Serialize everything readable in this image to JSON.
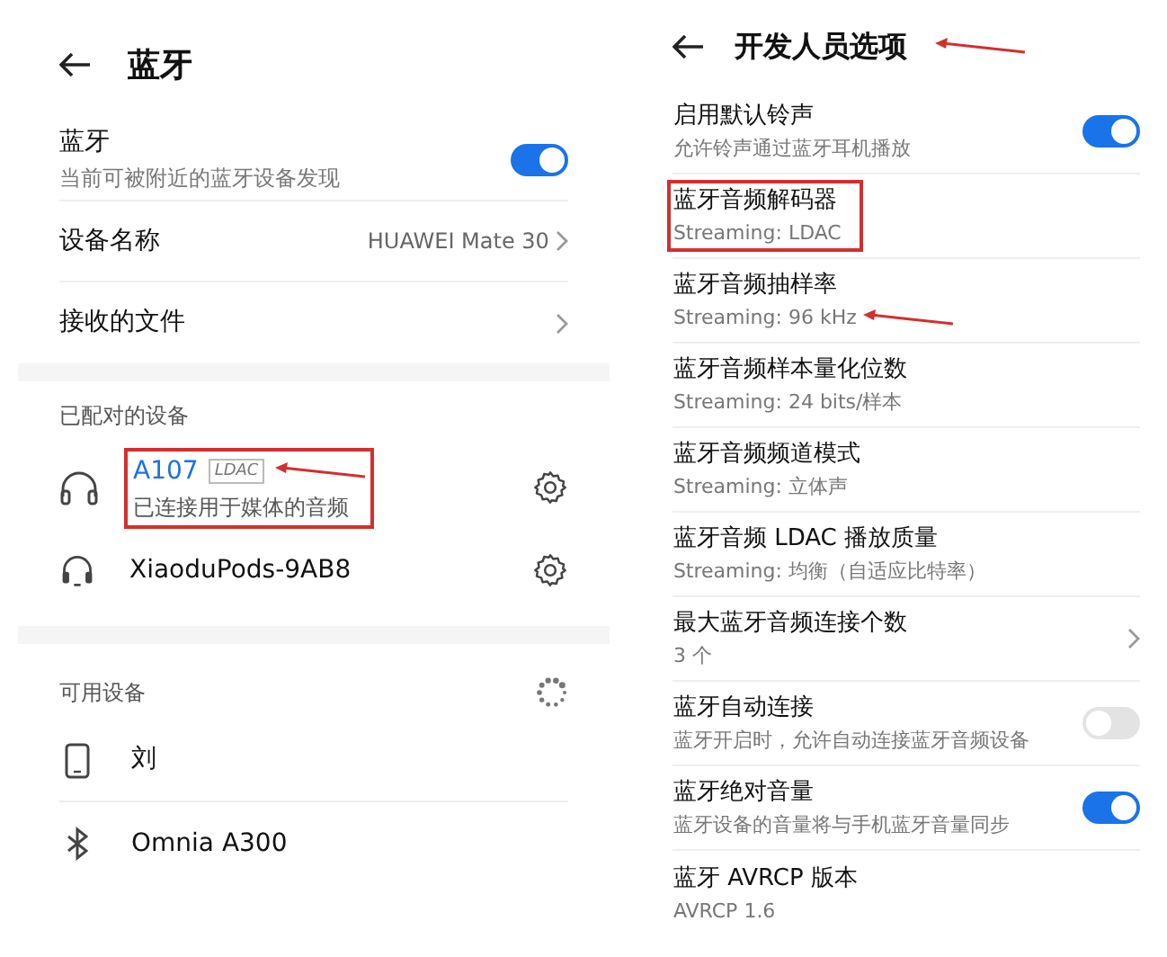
{
  "left": {
    "title": "蓝牙",
    "toggle": {
      "label": "蓝牙",
      "subtitle": "当前可被附近的蓝牙设备发现",
      "on": true
    },
    "links": [
      {
        "label": "设备名称",
        "value": "HUAWEI Mate 30"
      },
      {
        "label": "接收的文件"
      }
    ],
    "paired": {
      "heading": "已配对的设备",
      "devices": [
        {
          "kind": "headphones",
          "name": "A107",
          "badge": "LDAC",
          "status": "已连接用于媒体的音频",
          "connected": true,
          "highlighted": true
        },
        {
          "kind": "earbuds",
          "name": "XiaoduPods-9AB8",
          "connected": false,
          "highlighted": false
        }
      ]
    },
    "available": {
      "heading": "可用设备",
      "scanning": true,
      "devices": [
        {
          "kind": "phone",
          "name": "刘"
        },
        {
          "kind": "bluetooth",
          "name": "Omnia A300"
        }
      ]
    }
  },
  "right": {
    "title": "开发人员选项",
    "title_arrow": true,
    "items": [
      {
        "kind": "switch",
        "label": "启用默认铃声",
        "subtitle": "允许铃声通过蓝牙耳机播放",
        "on": true
      },
      {
        "kind": "info",
        "label": "蓝牙音频解码器",
        "subtitle": "Streaming: LDAC",
        "highlighted": true,
        "arrow": false
      },
      {
        "kind": "info",
        "label": "蓝牙音频抽样率",
        "subtitle": "Streaming: 96 kHz",
        "highlighted": false,
        "arrow": true
      },
      {
        "kind": "info",
        "label": "蓝牙音频样本量化位数",
        "subtitle": "Streaming: 24 bits/样本",
        "highlighted": false,
        "arrow": false
      },
      {
        "kind": "info",
        "label": "蓝牙音频频道模式",
        "subtitle": "Streaming: 立体声",
        "highlighted": false,
        "arrow": false
      },
      {
        "kind": "info",
        "label": "蓝牙音频 LDAC 播放质量",
        "subtitle": "Streaming: 均衡（自适应比特率）",
        "highlighted": false,
        "arrow": false
      },
      {
        "kind": "link",
        "label": "最大蓝牙音频连接个数",
        "subtitle": "3 个"
      },
      {
        "kind": "switch",
        "label": "蓝牙自动连接",
        "subtitle": "蓝牙开启时，允许自动连接蓝牙音频设备",
        "on": false
      },
      {
        "kind": "switch",
        "label": "蓝牙绝对音量",
        "subtitle": "蓝牙设备的音量将与手机蓝牙音量同步",
        "on": true
      },
      {
        "kind": "info",
        "label": "蓝牙 AVRCP 版本",
        "subtitle": "AVRCP 1.6",
        "highlighted": false,
        "arrow": false
      }
    ]
  }
}
